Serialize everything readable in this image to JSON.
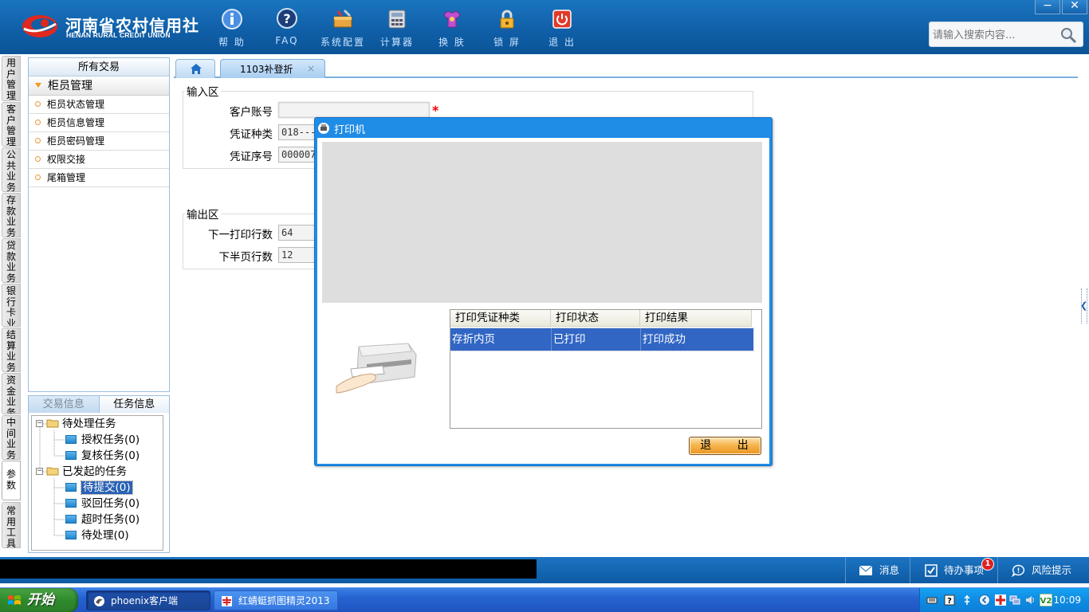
{
  "brand": {
    "name_cn": "河南省农村信用社",
    "name_en": "HENAN RURAL CREDIT UNION"
  },
  "toolbar": [
    {
      "label": "帮 助",
      "icon": "info-icon"
    },
    {
      "label": "FAQ",
      "icon": "faq-icon"
    },
    {
      "label": "系统配置",
      "icon": "toolbox-icon"
    },
    {
      "label": "计算器",
      "icon": "calculator-icon"
    },
    {
      "label": "换 肤",
      "icon": "shirt-icon"
    },
    {
      "label": "锁 屏",
      "icon": "lock-icon"
    },
    {
      "label": "退 出",
      "icon": "power-icon"
    }
  ],
  "window": {
    "minimize": "−",
    "close": "✕"
  },
  "search": {
    "placeholder": "请输入搜索内容..."
  },
  "categories": [
    "用户管理",
    "客户管理",
    "公共业务",
    "存款业务",
    "贷款业务",
    "银行卡业务",
    "结算业务",
    "资金业务",
    "中间业务",
    "参数",
    "常用工具"
  ],
  "menu": {
    "title": "所有交易",
    "group": "柜员管理",
    "items": [
      "柜员状态管理",
      "柜员信息管理",
      "柜员密码管理",
      "权限交接",
      "尾箱管理"
    ]
  },
  "task_panel": {
    "tabs": [
      "交易信息",
      "任务信息"
    ],
    "tree": {
      "pending": "待处理任务",
      "auth": "授权任务(0)",
      "review": "复核任务(0)",
      "initiated": "已发起的任务",
      "to_submit": "待提交(0)",
      "rejected": "驳回任务(0)",
      "timeout": "超时任务(0)",
      "to_process": "待处理(0)"
    }
  },
  "tabs": {
    "active": "1103补登折",
    "close": "×"
  },
  "form": {
    "input_section": "输入区",
    "account_label": "客户账号",
    "account_value": "",
    "voucher_type_label": "凭证种类",
    "voucher_type_value": "018----",
    "voucher_no_label": "凭证序号",
    "voucher_no_value": "000007",
    "required_mark": "*",
    "output_section": "输出区",
    "next_line_label": "下一打印行数",
    "next_line_value": "64",
    "half_page_label": "下半页行数",
    "half_page_value": "12"
  },
  "dialog": {
    "title": "打印机",
    "columns": [
      "打印凭证种类",
      "打印状态",
      "打印结果"
    ],
    "rows": [
      {
        "type": "存折内页",
        "status": "已打印",
        "result": "打印成功"
      }
    ],
    "exit_button": "退 出"
  },
  "statusbar": {
    "messages": "消息",
    "todo": "待办事项",
    "todo_badge": "1",
    "risk": "风险提示"
  },
  "taskbar": {
    "start": "开始",
    "tasks": [
      "phoenix客户端",
      "红蜻蜓抓图精灵2013"
    ],
    "clock": "10:09"
  },
  "colors": {
    "header_blue": "#0f5ea6",
    "selection_blue": "#3166c4",
    "dialog_border": "#1f8ce6",
    "exit_button_orange": "#f5b64f"
  }
}
